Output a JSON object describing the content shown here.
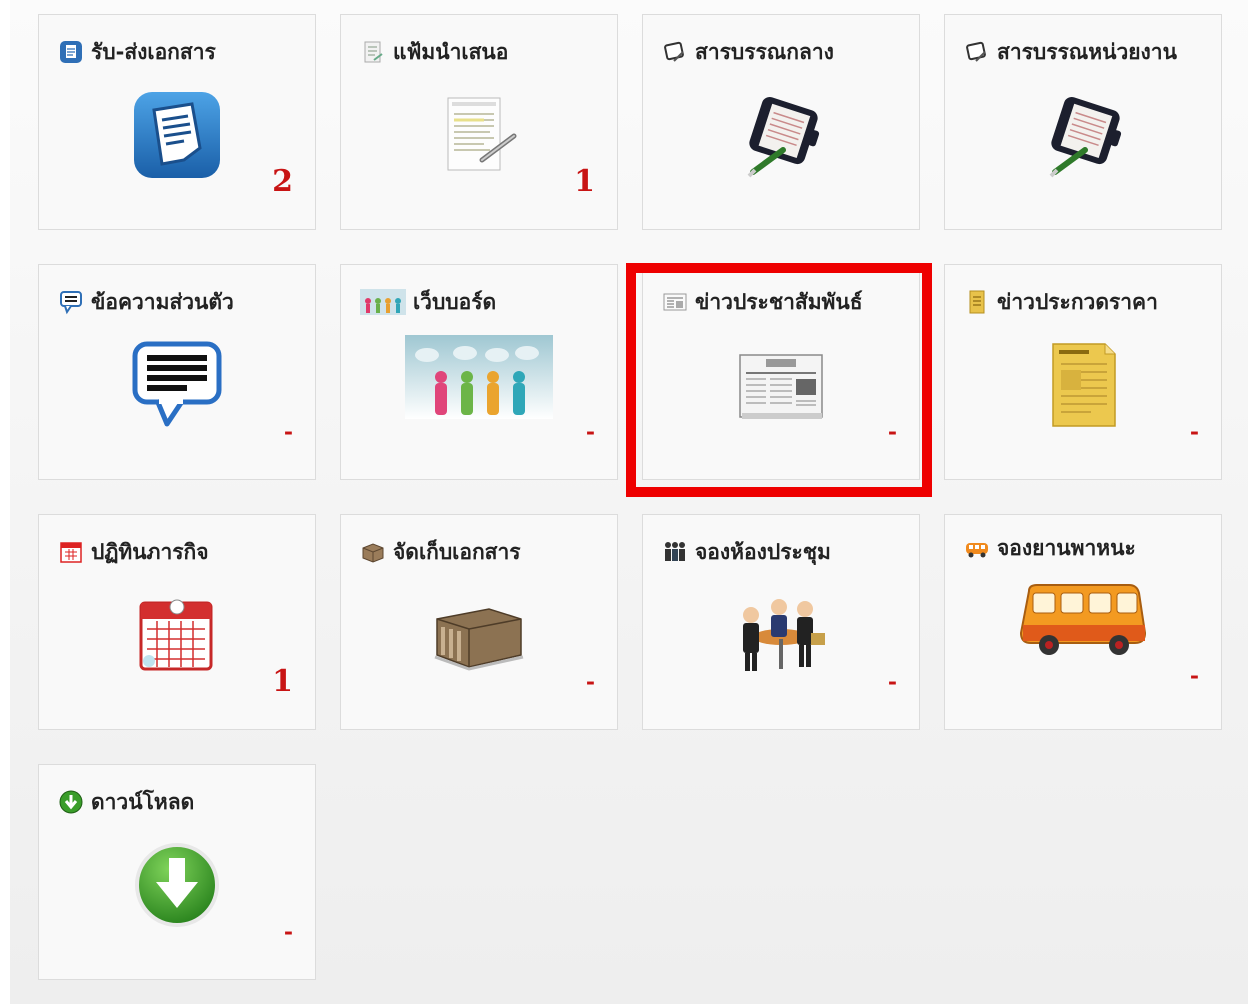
{
  "tiles": [
    {
      "id": "documents",
      "title": "รับ-ส่งเอกสาร",
      "count": "2",
      "icon": "document-icon"
    },
    {
      "id": "proposals",
      "title": "แฟ้มนำเสนอ",
      "count": "1",
      "icon": "file-folder-icon"
    },
    {
      "id": "central-directory",
      "title": "สารบรรณกลาง",
      "count": "",
      "icon": "organizer-icon"
    },
    {
      "id": "unit-directory",
      "title": "สารบรรณหน่วยงาน",
      "count": "",
      "icon": "organizer-icon"
    },
    {
      "id": "private-messages",
      "title": "ข้อความส่วนตัว",
      "count": "-",
      "icon": "chat-icon"
    },
    {
      "id": "webboard",
      "title": "เว็บบอร์ด",
      "count": "-",
      "icon": "people-icon"
    },
    {
      "id": "press-news",
      "title": "ข่าวประชาสัมพันธ์",
      "count": "-",
      "icon": "newspaper-icon"
    },
    {
      "id": "price-news",
      "title": "ข่าวประกวดราคา",
      "count": "-",
      "icon": "notepad-icon"
    },
    {
      "id": "calendar",
      "title": "ปฏิทินภารกิจ",
      "count": "1",
      "icon": "calendar-icon"
    },
    {
      "id": "archive",
      "title": "จัดเก็บเอกสาร",
      "count": "-",
      "icon": "archive-box-icon"
    },
    {
      "id": "meeting-room",
      "title": "จองห้องประชุม",
      "count": "-",
      "icon": "meeting-icon"
    },
    {
      "id": "vehicle",
      "title": "จองยานพาหนะ",
      "count": "-",
      "icon": "bus-icon"
    },
    {
      "id": "download",
      "title": "ดาวน์โหลด",
      "count": "-",
      "icon": "download-icon"
    }
  ],
  "highlighted_tile": "press-news",
  "colors": {
    "count": "#c81414",
    "highlight": "#ee0000",
    "tile_bg": "#f9f9f9",
    "tile_border": "#dcdcdc"
  }
}
